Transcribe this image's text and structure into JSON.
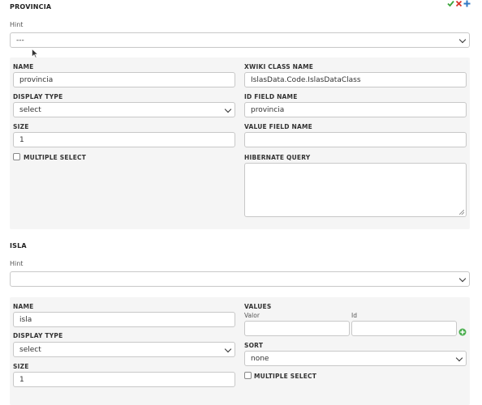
{
  "header_icons": [
    "check-icon",
    "delete-icon",
    "move-icon"
  ],
  "provincia": {
    "title": "PROVINCIA",
    "hint_label": "Hint",
    "hint_value": "---",
    "name_label": "NAME",
    "name_value": "provincia",
    "display_type_label": "DISPLAY TYPE",
    "display_type_value": "select",
    "size_label": "SIZE",
    "size_value": "1",
    "multiple_select_label": "MULTIPLE SELECT",
    "xwiki_class_label": "XWIKI CLASS NAME",
    "xwiki_class_value": "IslasData.Code.IslasDataClass",
    "id_field_label": "ID FIELD NAME",
    "id_field_value": "provincia",
    "value_field_label": "VALUE FIELD NAME",
    "value_field_value": "",
    "hibernate_label": "HIBERNATE QUERY",
    "hibernate_value": ""
  },
  "isla": {
    "title": "ISLA",
    "hint_label": "Hint",
    "hint_value": "",
    "name_label": "NAME",
    "name_value": "isla",
    "display_type_label": "DISPLAY TYPE",
    "display_type_value": "select",
    "size_label": "SIZE",
    "size_value": "1",
    "values_label": "VALUES",
    "valor_label": "Valor",
    "id_label": "Id",
    "valor_value": "",
    "id_value": "",
    "sort_label": "SORT",
    "sort_value": "none",
    "multiple_select_label": "MULTIPLE SELECT"
  },
  "colors": {
    "check": "#3aa53a",
    "delete": "#d9342b",
    "move": "#2f78c4",
    "add": "#4caf50"
  }
}
